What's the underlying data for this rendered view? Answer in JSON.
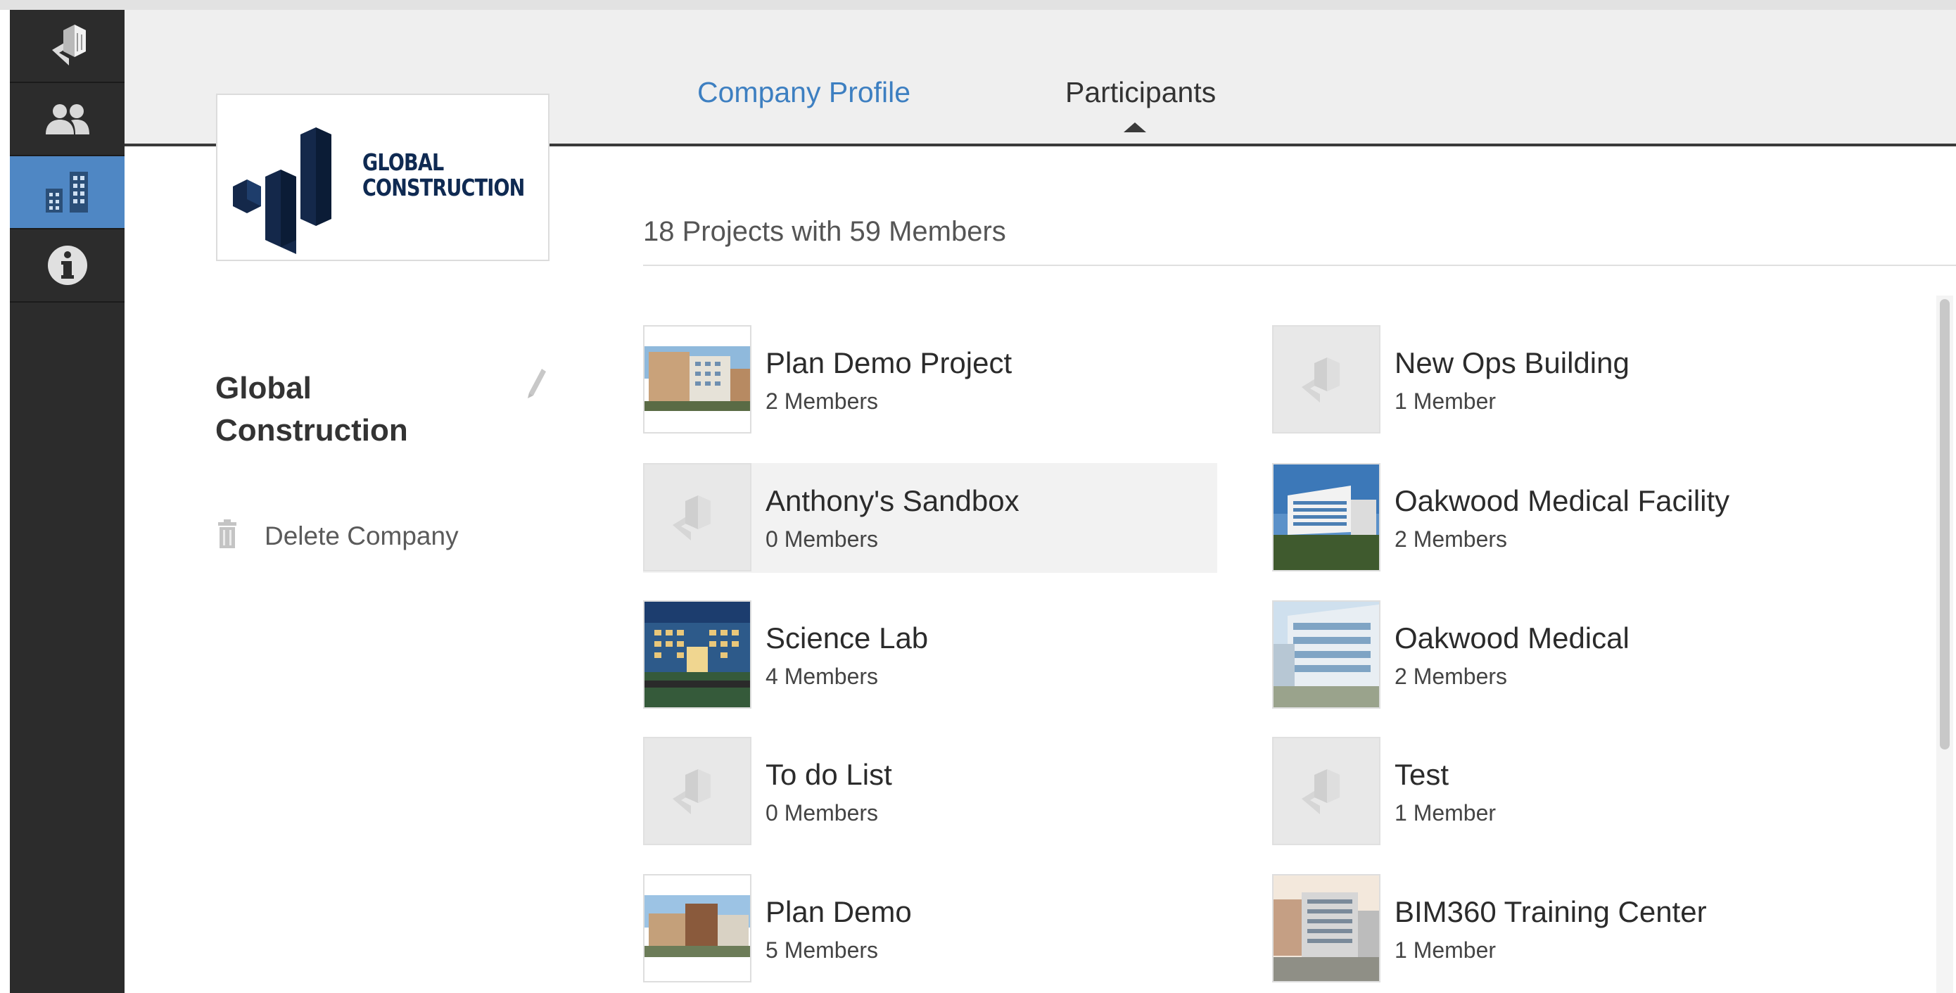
{
  "rail": {
    "items": [
      {
        "icon": "app-logo-icon",
        "active": false
      },
      {
        "icon": "users-icon",
        "active": false
      },
      {
        "icon": "buildings-icon",
        "active": true
      },
      {
        "icon": "info-icon",
        "active": false
      }
    ]
  },
  "tabs": {
    "profile": "Company Profile",
    "participants": "Participants",
    "active": "Participants"
  },
  "logo": {
    "line1": "GLOBAL",
    "line2": "CONSTRUCTION",
    "color": "#0f2a52"
  },
  "company": {
    "name": "Global Construction",
    "delete_label": "Delete Company"
  },
  "summary": "18 Projects with 59 Members",
  "projects": [
    {
      "name": "Plan Demo Project",
      "members": "2 Members",
      "thumb": "photo"
    },
    {
      "name": "New Ops Building",
      "members": "1 Member",
      "thumb": "placeholder"
    },
    {
      "name": "Anthony's Sandbox",
      "members": "0 Members",
      "thumb": "placeholder"
    },
    {
      "name": "Oakwood Medical Facility",
      "members": "2 Members",
      "thumb": "photo"
    },
    {
      "name": "Science Lab",
      "members": "4 Members",
      "thumb": "photo"
    },
    {
      "name": "Oakwood Medical",
      "members": "2 Members",
      "thumb": "photo"
    },
    {
      "name": "To do List",
      "members": "0 Members",
      "thumb": "placeholder"
    },
    {
      "name": "Test",
      "members": "1 Member",
      "thumb": "placeholder"
    },
    {
      "name": "Plan Demo",
      "members": "5 Members",
      "thumb": "photo"
    },
    {
      "name": "BIM360 Training Center",
      "members": "1 Member",
      "thumb": "photo"
    }
  ],
  "colors": {
    "rail": "#2c2c2c",
    "rail_active": "#4f87c4",
    "tab_link": "#3d7fc1",
    "header": "#efefef"
  }
}
